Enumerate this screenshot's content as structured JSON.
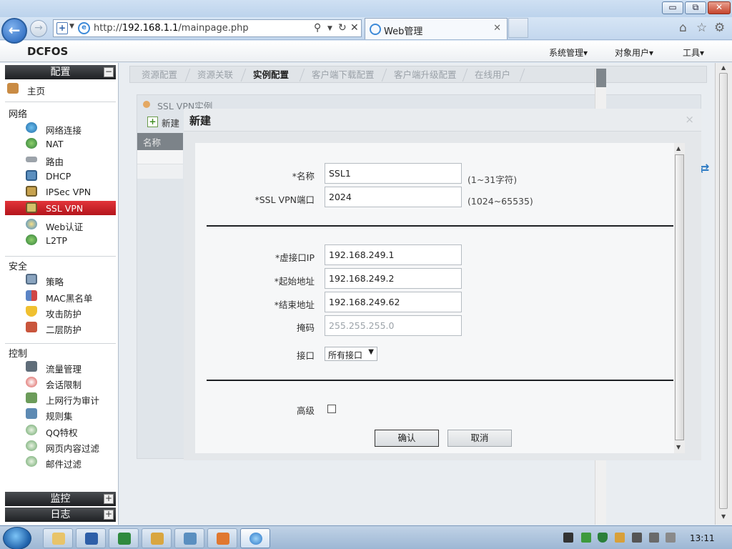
{
  "browser": {
    "url_prefix": "http://",
    "url_host": "192.168.1.1",
    "url_path": "/mainpage.php",
    "tab_title": "Web管理",
    "controls": {
      "minimize": "▭",
      "maximize": "⧉",
      "close": "✕"
    }
  },
  "app": {
    "brand": "DCFOS",
    "menus": [
      "系统管理▾",
      "对象用户▾",
      "工具▾"
    ]
  },
  "sidebar": {
    "config_label": "配置",
    "config_toggle": "−",
    "home": "主页",
    "sections": {
      "network": "网络",
      "security": "安全",
      "control": "控制"
    },
    "network_items": [
      "网络连接",
      "NAT",
      "路由",
      "DHCP",
      "IPSec VPN",
      "SSL VPN",
      "Web认证",
      "L2TP"
    ],
    "security_items": [
      "策略",
      "MAC黑名单",
      "攻击防护",
      "二层防护"
    ],
    "control_items": [
      "流量管理",
      "会话限制",
      "上网行为审计",
      "规则集",
      "QQ特权",
      "网页内容过滤",
      "邮件过滤"
    ],
    "monitor_label": "监控",
    "log_label": "日志",
    "expand_toggle": "+"
  },
  "content": {
    "tabs": [
      "资源配置",
      "资源关联",
      "实例配置",
      "客户端下载配置",
      "客户端升级配置",
      "在线用户"
    ],
    "active_tab": "实例配置",
    "section_title": "SSL VPN实例",
    "new_button": "新建",
    "column_name": "名称"
  },
  "dialog": {
    "title": "新建",
    "close": "×",
    "fields": {
      "name_label": "*名称",
      "name_value": "SSL1",
      "name_hint": "(1~31字符)",
      "port_label": "*SSL VPN端口",
      "port_value": "2024",
      "port_hint": "(1024~65535)",
      "vip_label": "*虚接口IP",
      "vip_value": "192.168.249.1",
      "start_label": "*起始地址",
      "start_value": "192.168.249.2",
      "end_label": "*结束地址",
      "end_value": "192.168.249.62",
      "mask_label": "掩码",
      "mask_placeholder": "255.255.255.0",
      "iface_label": "接口",
      "iface_value": "所有接口",
      "advanced_label": "高级"
    },
    "confirm": "确认",
    "cancel": "取消"
  },
  "taskbar": {
    "clock": "13:11"
  }
}
